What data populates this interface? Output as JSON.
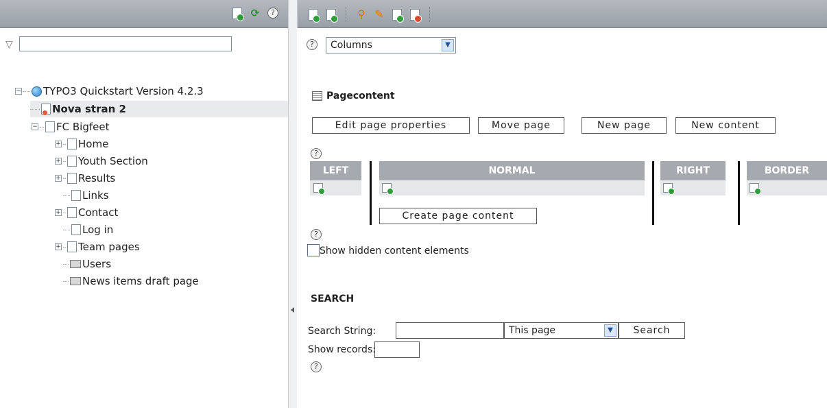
{
  "left_toolbar": {
    "icons": [
      "new-page-icon",
      "refresh-icon",
      "help-icon"
    ]
  },
  "right_toolbar": {
    "icons": [
      "new-page-icon",
      "new-content-icon",
      "search-icon",
      "edit-icon",
      "move-icon",
      "schedule-icon"
    ]
  },
  "filter": {
    "value": "",
    "placeholder": ""
  },
  "tree": {
    "root": "TYPO3 Quickstart Version 4.2.3",
    "items": [
      {
        "label": "Nova stran 2"
      },
      {
        "label": "FC Bigfeet"
      },
      {
        "label": "Home"
      },
      {
        "label": "Youth Section"
      },
      {
        "label": "Results"
      },
      {
        "label": "Links"
      },
      {
        "label": "Contact"
      },
      {
        "label": "Log in"
      },
      {
        "label": "Team pages"
      },
      {
        "label": "Users"
      },
      {
        "label": "News items draft page"
      }
    ]
  },
  "view_select": {
    "value": "Columns"
  },
  "pagecontent": {
    "title": "Pagecontent",
    "buttons": [
      "Edit page properties",
      "Move page",
      "New page",
      "New content"
    ],
    "columns": [
      "LEFT",
      "NORMAL",
      "RIGHT",
      "BORDER"
    ],
    "create_label": "Create page content",
    "show_hidden_label": "Show hidden content elements"
  },
  "search": {
    "title": "SEARCH",
    "string_label": "Search String:",
    "scope_value": "This page",
    "button_label": "Search",
    "records_label": "Show records:"
  }
}
